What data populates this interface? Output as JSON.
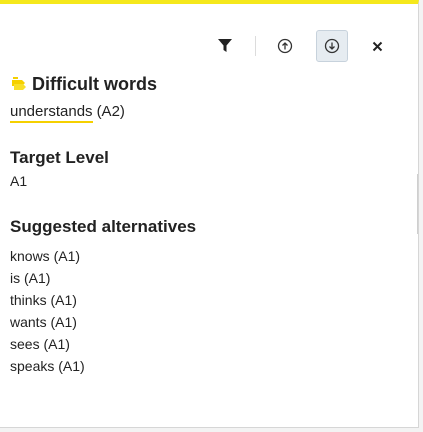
{
  "toolbar": {
    "filter_icon": "filter-icon",
    "up_icon": "arrow-up-circle-icon",
    "down_icon": "arrow-down-circle-icon",
    "close_label": "×"
  },
  "colors": {
    "accent_yellow": "#f5e81c",
    "underline_yellow": "#f5d000",
    "text": "#222222"
  },
  "difficult": {
    "icon": "difficult-words-icon",
    "title": "Difficult words",
    "word": "understands",
    "level": "(A2)"
  },
  "target": {
    "title": "Target Level",
    "value": "A1"
  },
  "alternatives": {
    "title": "Suggested alternatives",
    "items": [
      "knows (A1)",
      "is (A1)",
      "thinks (A1)",
      "wants (A1)",
      "sees (A1)",
      "speaks (A1)"
    ]
  }
}
